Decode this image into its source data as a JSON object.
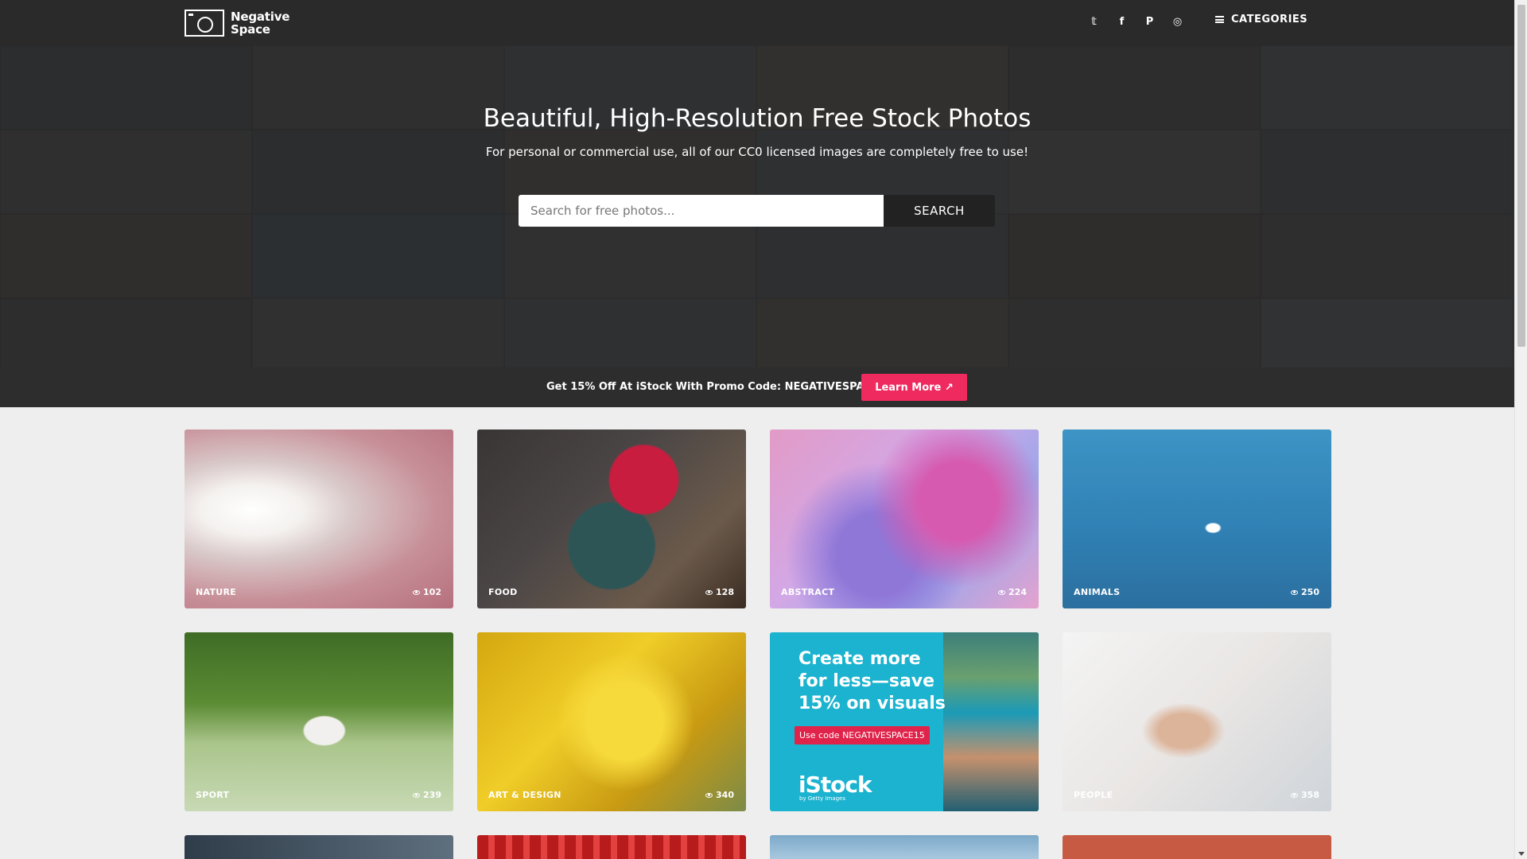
{
  "header": {
    "logo_line1": "Negative",
    "logo_line2": "Space",
    "social": [
      {
        "icon": "twitter-icon",
        "glyph": "𝕥"
      },
      {
        "icon": "facebook-icon",
        "glyph": "f"
      },
      {
        "icon": "pinterest-icon",
        "glyph": "P"
      },
      {
        "icon": "instagram-icon",
        "glyph": "◎"
      }
    ],
    "categories_label": "CATEGORIES"
  },
  "hero": {
    "title": "Beautiful, High-Resolution Free Stock Photos",
    "subtitle": "For personal or commercial use, all of our CC0 licensed images are completely free to use!",
    "search_placeholder": "Search for free photos...",
    "search_button": "SEARCH"
  },
  "promo": {
    "text": "Get 15% Off At iStock With Promo Code: NEGATIVESPACE15",
    "button": "Learn More"
  },
  "cards": [
    {
      "label": "NATURE",
      "views": "102"
    },
    {
      "label": "FOOD",
      "views": "128"
    },
    {
      "label": "ABSTRACT",
      "views": "224"
    },
    {
      "label": "ANIMALS",
      "views": "250"
    },
    {
      "label": "SPORT",
      "views": "239"
    },
    {
      "label": "ART & DESIGN",
      "views": "340"
    },
    {
      "label": "PEOPLE",
      "views": "358"
    }
  ],
  "ad": {
    "title_line1": "Create more",
    "title_line2": "for less—save",
    "title_line3": "15% on visuals",
    "code": "Use code NEGATIVESPACE15",
    "logo": "iStock",
    "sublogo": "by Getty Images"
  },
  "colors": {
    "header_bg": "#2a2a2a",
    "promo_button": "#ee2a5f",
    "ad_bg": "#1bb3cf"
  }
}
